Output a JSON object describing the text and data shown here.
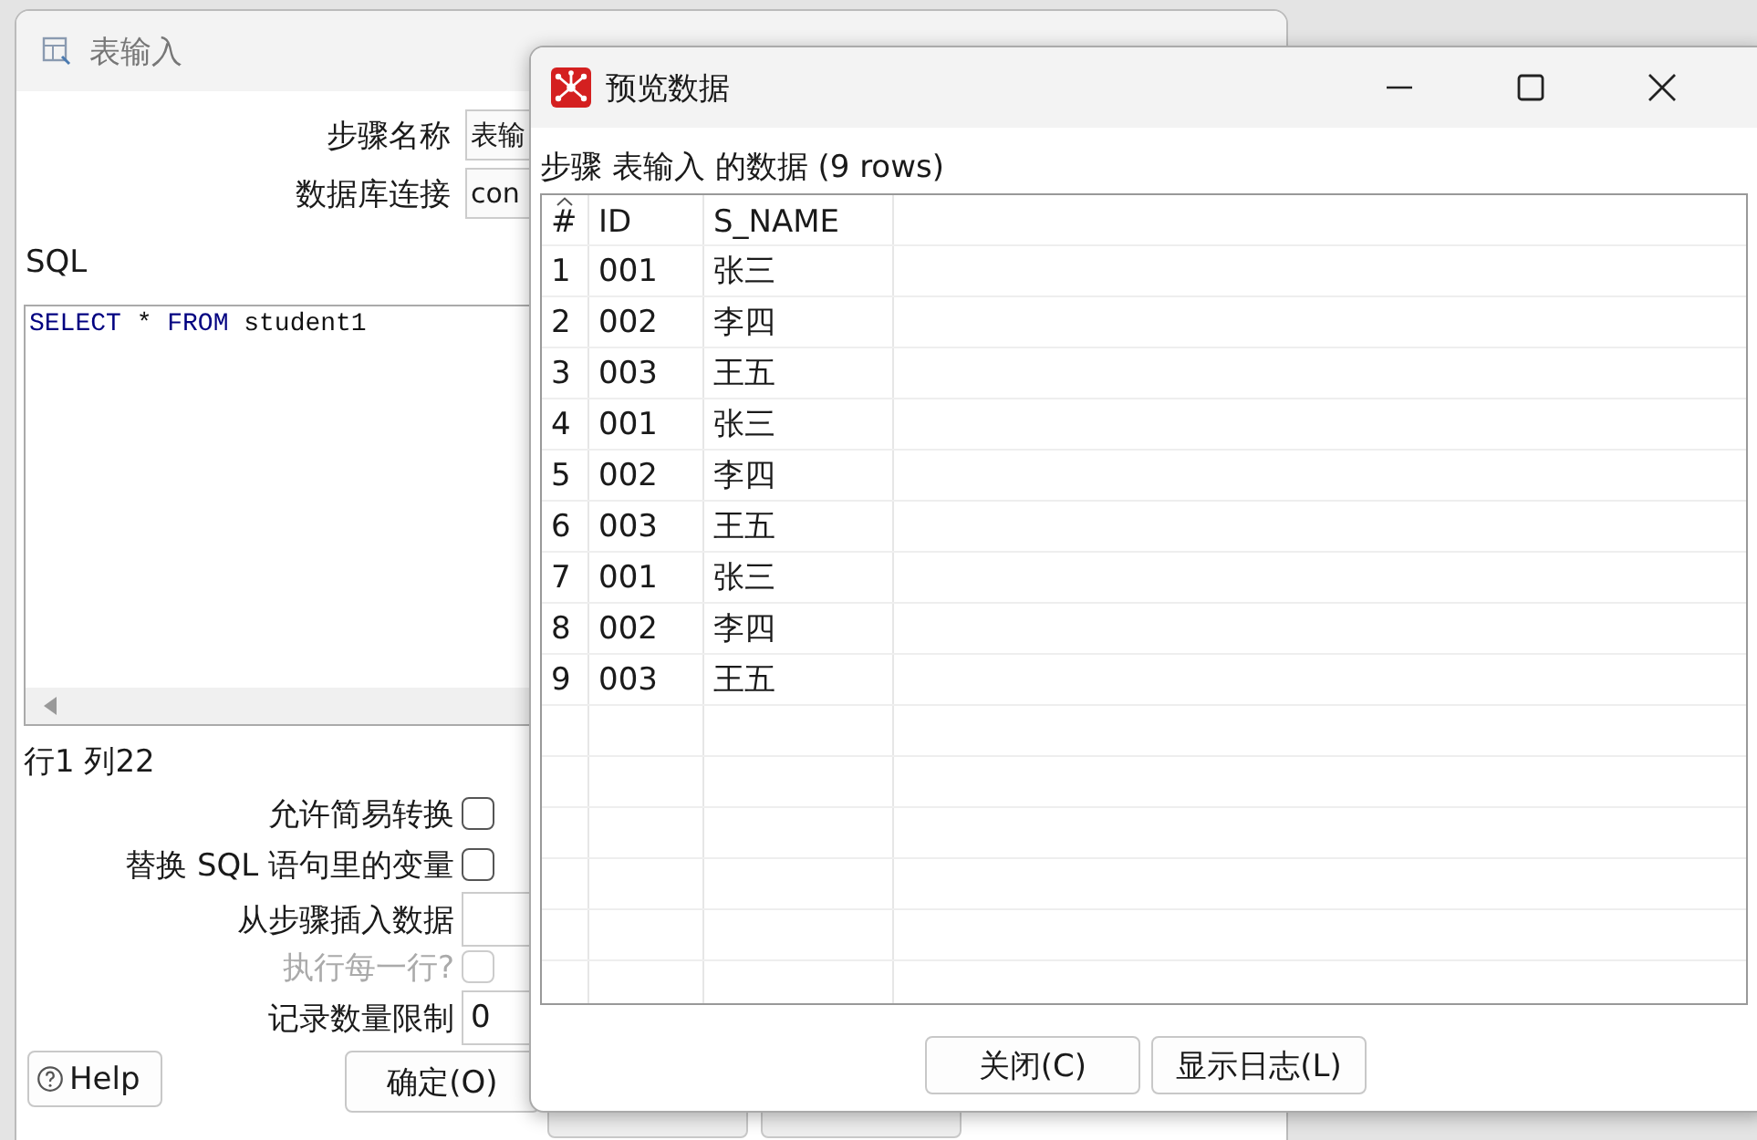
{
  "main_dialog": {
    "title": "表输入",
    "step_name": {
      "label": "步骤名称",
      "value": "表输"
    },
    "connection": {
      "label": "数据库连接",
      "value": "con"
    },
    "sql_label": "SQL",
    "sql_tokens": [
      {
        "kind": "keyword",
        "text": "SELECT"
      },
      {
        "kind": "plain",
        "text": "*"
      },
      {
        "kind": "keyword",
        "text": "FROM"
      },
      {
        "kind": "plain",
        "text": "student1"
      }
    ],
    "cursor_position": "行1 列22",
    "options": [
      {
        "kind": "checkbox",
        "label": "允许简易转换",
        "checked": false,
        "disabled": false
      },
      {
        "kind": "checkbox",
        "label": "替换 SQL 语句里的变量",
        "checked": false,
        "disabled": false
      },
      {
        "kind": "field",
        "label": "从步骤插入数据"
      },
      {
        "kind": "checkbox",
        "label": "执行每一行?",
        "checked": false,
        "disabled": true
      },
      {
        "kind": "field",
        "label": "记录数量限制",
        "value": "0"
      }
    ],
    "buttons": [
      {
        "kind": "help",
        "label": "Help"
      },
      {
        "kind": "plain",
        "label": "确定(O)"
      }
    ]
  },
  "preview_dialog": {
    "title": "预览数据",
    "caption": "步骤 表输入 的数据  (9 rows)",
    "columns": [
      "#",
      "ID",
      "S_NAME"
    ],
    "rows": [
      [
        "1",
        "001",
        "张三"
      ],
      [
        "2",
        "002",
        "李四"
      ],
      [
        "3",
        "003",
        "王五"
      ],
      [
        "4",
        "001",
        "张三"
      ],
      [
        "5",
        "002",
        "李四"
      ],
      [
        "6",
        "003",
        "王五"
      ],
      [
        "7",
        "001",
        "张三"
      ],
      [
        "8",
        "002",
        "李四"
      ],
      [
        "9",
        "003",
        "王五"
      ]
    ],
    "buttons": [
      "关闭(C)",
      "显示日志(L)"
    ]
  }
}
